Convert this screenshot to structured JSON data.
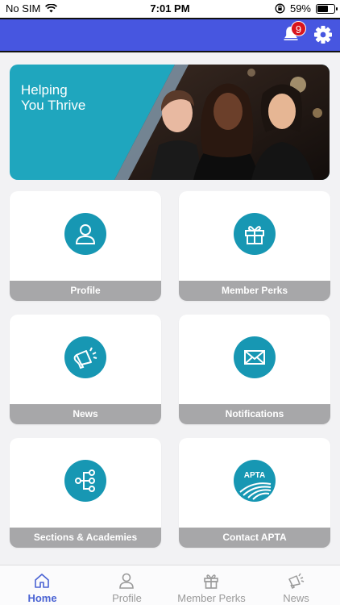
{
  "status_bar": {
    "carrier": "No SIM",
    "time": "7:01 PM",
    "battery": "59%"
  },
  "header": {
    "notification_count": "9"
  },
  "banner": {
    "line1": "Helping",
    "line2": "You Thrive"
  },
  "tiles": [
    {
      "label": "Profile",
      "icon": "person-icon"
    },
    {
      "label": "Member Perks",
      "icon": "gift-icon"
    },
    {
      "label": "News",
      "icon": "megaphone-icon"
    },
    {
      "label": "Notifications",
      "icon": "envelope-icon"
    },
    {
      "label": "Sections & Academies",
      "icon": "hierarchy-icon"
    },
    {
      "label": "Contact APTA",
      "icon": "apta-logo",
      "logo_text": "APTA"
    }
  ],
  "tab_bar": [
    {
      "label": "Home",
      "icon": "home-icon",
      "active": true
    },
    {
      "label": "Profile",
      "icon": "person-icon"
    },
    {
      "label": "Member Perks",
      "icon": "gift-icon"
    },
    {
      "label": "News",
      "icon": "megaphone-icon"
    }
  ],
  "colors": {
    "header": "#4756e0",
    "accent": "#1797b3",
    "tile_label_bg": "#a7a7a9",
    "tab_active": "#4a63d3",
    "badge": "#d9151d"
  }
}
